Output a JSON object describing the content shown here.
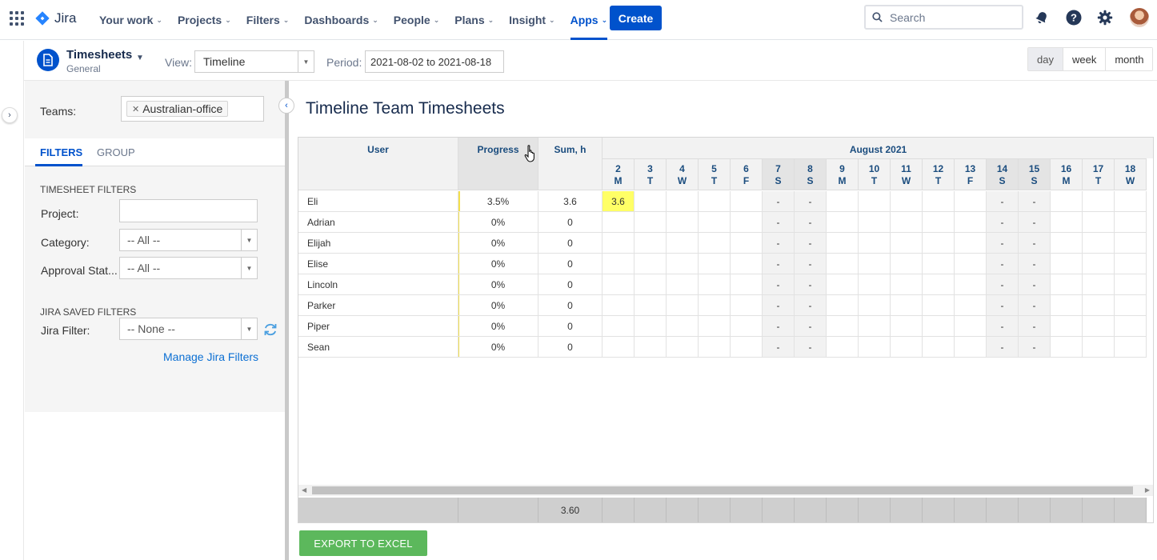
{
  "topnav": {
    "app_name": "Jira",
    "items": [
      {
        "label": "Your work",
        "active": false
      },
      {
        "label": "Projects",
        "active": false
      },
      {
        "label": "Filters",
        "active": false
      },
      {
        "label": "Dashboards",
        "active": false
      },
      {
        "label": "People",
        "active": false
      },
      {
        "label": "Plans",
        "active": false
      },
      {
        "label": "Insight",
        "active": false
      },
      {
        "label": "Apps",
        "active": true
      }
    ],
    "create_label": "Create",
    "search_placeholder": "Search",
    "accent": "#0052cc"
  },
  "subheader": {
    "title": "Timesheets",
    "subtitle": "General",
    "view_label": "View:",
    "view_value": "Timeline",
    "period_label": "Period:",
    "period_value": "2021-08-02 to 2021-08-18",
    "scale": [
      "day",
      "week",
      "month"
    ],
    "scale_active": "day"
  },
  "sidebar": {
    "teams_label": "Teams:",
    "team_chip": "Australian-office",
    "tabs": {
      "filters": "FILTERS",
      "group": "GROUP"
    },
    "timesheet_filters_title": "TIMESHEET FILTERS",
    "project_label": "Project:",
    "category_label": "Category:",
    "category_value": "-- All --",
    "approval_label": "Approval Stat...",
    "approval_value": "-- All --",
    "jira_saved_filters_title": "JIRA SAVED FILTERS",
    "jira_filter_label": "Jira Filter:",
    "jira_filter_value": "-- None --",
    "manage_link": "Manage Jira Filters"
  },
  "main": {
    "title": "Timeline Team Timesheets",
    "headers": {
      "user": "User",
      "progress": "Progress",
      "sum": "Sum, h",
      "month": "August 2021"
    },
    "days": [
      {
        "num": "2",
        "dow": "M",
        "weekend": false
      },
      {
        "num": "3",
        "dow": "T",
        "weekend": false
      },
      {
        "num": "4",
        "dow": "W",
        "weekend": false
      },
      {
        "num": "5",
        "dow": "T",
        "weekend": false
      },
      {
        "num": "6",
        "dow": "F",
        "weekend": false
      },
      {
        "num": "7",
        "dow": "S",
        "weekend": true
      },
      {
        "num": "8",
        "dow": "S",
        "weekend": true
      },
      {
        "num": "9",
        "dow": "M",
        "weekend": false
      },
      {
        "num": "10",
        "dow": "T",
        "weekend": false
      },
      {
        "num": "11",
        "dow": "W",
        "weekend": false
      },
      {
        "num": "12",
        "dow": "T",
        "weekend": false
      },
      {
        "num": "13",
        "dow": "F",
        "weekend": false
      },
      {
        "num": "14",
        "dow": "S",
        "weekend": true
      },
      {
        "num": "15",
        "dow": "S",
        "weekend": true
      },
      {
        "num": "16",
        "dow": "M",
        "weekend": false
      },
      {
        "num": "17",
        "dow": "T",
        "weekend": false
      },
      {
        "num": "18",
        "dow": "W",
        "weekend": false
      }
    ],
    "rows": [
      {
        "user": "Eli",
        "progress": "3.5%",
        "progress_value": 0.035,
        "sum": "3.6",
        "day_values": {
          "0": "3.6"
        }
      },
      {
        "user": "Adrian",
        "progress": "0%",
        "progress_value": 0,
        "sum": "0",
        "day_values": {}
      },
      {
        "user": "Elijah",
        "progress": "0%",
        "progress_value": 0,
        "sum": "0",
        "day_values": {}
      },
      {
        "user": "Elise",
        "progress": "0%",
        "progress_value": 0,
        "sum": "0",
        "day_values": {}
      },
      {
        "user": "Lincoln",
        "progress": "0%",
        "progress_value": 0,
        "sum": "0",
        "day_values": {}
      },
      {
        "user": "Parker",
        "progress": "0%",
        "progress_value": 0,
        "sum": "0",
        "day_values": {}
      },
      {
        "user": "Piper",
        "progress": "0%",
        "progress_value": 0,
        "sum": "0",
        "day_values": {}
      },
      {
        "user": "Sean",
        "progress": "0%",
        "progress_value": 0,
        "sum": "0",
        "day_values": {}
      }
    ],
    "weekend_placeholder": "-",
    "total_sum": "3.60",
    "export_label": "EXPORT TO EXCEL",
    "highlight_color": "#ffff66",
    "export_color": "#5cb85c"
  }
}
